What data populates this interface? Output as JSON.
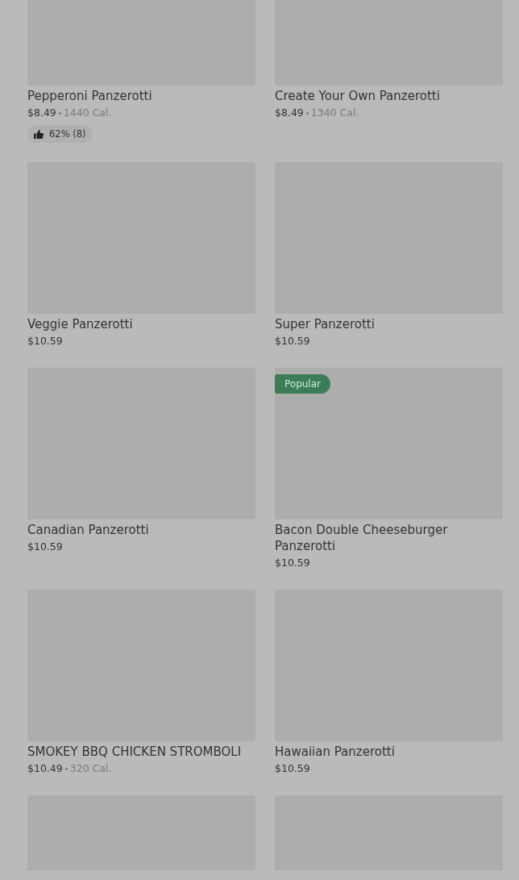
{
  "rows": [
    {
      "items": [
        {
          "name": "Pepperoni Panzerotti",
          "price": "$8.49",
          "calories": "1440 Cal.",
          "rating": "62% (8)"
        },
        {
          "name": "Create Your Own Panzerotti",
          "price": "$8.49",
          "calories": "1340 Cal."
        }
      ]
    },
    {
      "items": [
        {
          "name": "Veggie Panzerotti",
          "price": "$10.59"
        },
        {
          "name": "Super Panzerotti",
          "price": "$10.59"
        }
      ]
    },
    {
      "items": [
        {
          "name": "Canadian Panzerotti",
          "price": "$10.59"
        },
        {
          "name": "Bacon Double Cheeseburger Panzerotti",
          "price": "$10.59",
          "badge": "Popular"
        }
      ]
    },
    {
      "items": [
        {
          "name": "SMOKEY BBQ CHICKEN STROMBOLI",
          "price": "$10.49",
          "calories": "320 Cal."
        },
        {
          "name": "Hawaiian Panzerotti",
          "price": "$10.59"
        }
      ]
    },
    {
      "items": [
        {
          "kind": "image-only"
        },
        {
          "kind": "image-only"
        }
      ]
    }
  ]
}
